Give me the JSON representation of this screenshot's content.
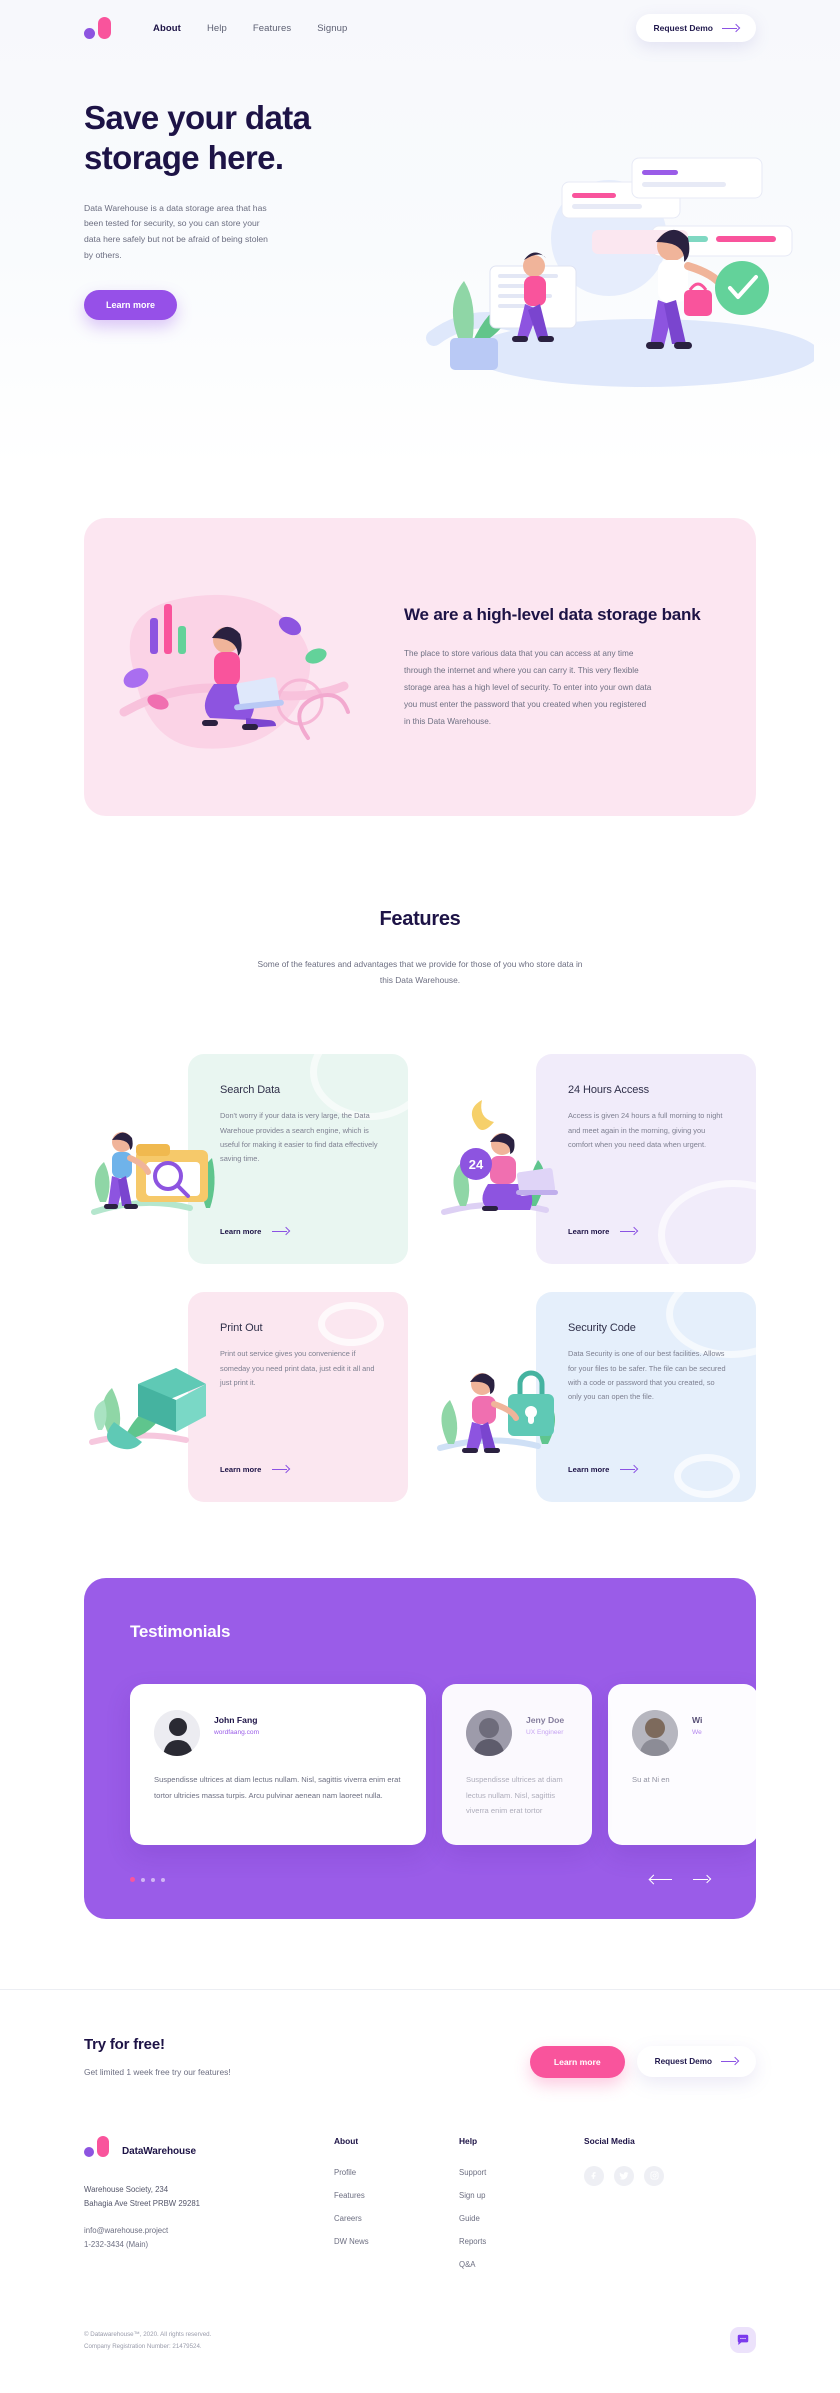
{
  "nav": {
    "links": [
      {
        "label": "About",
        "active": true
      },
      {
        "label": "Help",
        "active": false
      },
      {
        "label": "Features",
        "active": false
      },
      {
        "label": "Signup",
        "active": false
      }
    ],
    "cta": "Request Demo"
  },
  "hero": {
    "title_line1": "Save your data",
    "title_line2": "storage here.",
    "paragraph": "Data Warehouse is a data storage area that has been  tested for security, so you can store your data here  safely but not be afraid of being stolen by others.",
    "button": "Learn more"
  },
  "bank": {
    "title": "We are a high-level data storage bank",
    "paragraph": "The place to store various data that you can access at any time through the internet  and where you can carry it. This very flexible storage area has a high level of security. To enter into your own data you must enter the password that you created when you registered in this Data Warehouse."
  },
  "features": {
    "title": "Features",
    "subtitle": "Some of the features and advantages that we provide for those of you who store data in this Data Warehouse.",
    "learn_more": "Learn more",
    "cards": [
      {
        "title": "Search Data",
        "body": "Don't worry if your data is very large, the Data Warehoue provides a search engine, which is useful for making it easier to find data effectively saving time.",
        "color": "#e9f6f1"
      },
      {
        "title": "24 Hours Access",
        "body": "Access is given 24 hours a full morning to night and  meet again in the morning, giving you comfort when  you need data when urgent.",
        "color": "#f1ecfa"
      },
      {
        "title": "Print Out",
        "body": "Print out service gives you convenience if someday  you need print data, just edit it all and just print it.",
        "color": "#fbe7f0"
      },
      {
        "title": "Security Code",
        "body": "Data Security is one of our best facilities. Allows for your files  to be safer. The file can be secured with a code or password that   you created, so only you can open the file.",
        "color": "#e5effb"
      }
    ]
  },
  "testimonials": {
    "title": "Testimonials",
    "items": [
      {
        "name": "John Fang",
        "role": "wordfaang.com",
        "quote": "Suspendisse ultrices at diam lectus nullam. Nisl, sagittis viverra enim erat tortor ultricies massa turpis. Arcu pulvinar aenean nam laoreet nulla."
      },
      {
        "name": "Jeny Doe",
        "role": "UX Engineer",
        "quote": "Suspendisse ultrices at diam lectus nullam. Nisl, sagittis viverra enim erat tortor"
      },
      {
        "name": "Wi",
        "role": "We",
        "quote": "Su at Ni en"
      }
    ],
    "dot_count": 4,
    "active_dot": 1
  },
  "tryfree": {
    "title": "Try for free!",
    "subtitle": "Get limited 1 week free try our features!",
    "primary": "Learn more",
    "secondary": "Request Demo"
  },
  "footer": {
    "brand": "DataWarehouse",
    "address_line1": "Warehouse Society, 234",
    "address_line2": "Bahagia Ave Street   PRBW 29281",
    "email": "info@warehouse.project",
    "phone": "1-232-3434 (Main)",
    "columns": [
      {
        "heading": "About",
        "items": [
          "Profile",
          "Features",
          "Careers",
          "DW News"
        ]
      },
      {
        "heading": "Help",
        "items": [
          "Support",
          "Sign up",
          "Guide",
          "Reports",
          "Q&A"
        ]
      }
    ],
    "social_heading": "Social Media",
    "socials": [
      "facebook-icon",
      "twitter-icon",
      "instagram-icon"
    ],
    "copyright": "© Datawarehouse™, 2020. All rights reserved.",
    "registration": "Company Registration Number: 21479524."
  }
}
